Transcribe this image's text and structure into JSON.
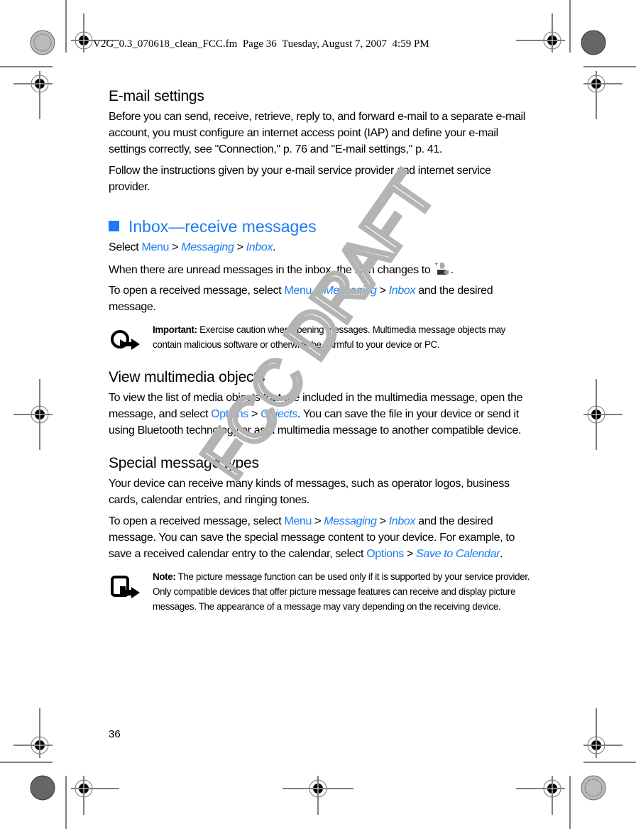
{
  "header": {
    "file_line": "V2G_0.3_070618_clean_FCC.fm  Page 36  Tuesday, August 7, 2007  4:59 PM"
  },
  "email_settings": {
    "heading": "E-mail settings",
    "p1": "Before you can send, receive, retrieve, reply to, and forward e-mail to a separate e-mail account, you must configure an internet access point (IAP) and define your e-mail settings correctly, see \"Connection,\" p. 76 and \"E-mail settings,\" p. 41.",
    "p2": "Follow the instructions given by your e-mail service provider and internet service provider."
  },
  "inbox": {
    "heading": "Inbox—receive messages",
    "select_prefix": "Select ",
    "menu": "Menu",
    "sep": " > ",
    "messaging": "Messaging",
    "inbox": "Inbox",
    "period": ".",
    "unread_text": "When there are unread messages in the inbox, the icon changes to ",
    "unread_icon": "new-message-inbox-icon",
    "open_prefix": "To open a received message, select ",
    "open_suffix": " and the desired message.",
    "important_label": "Important:",
    "important_text": " Exercise caution when opening messages. Multimedia message objects may contain malicious software or otherwise be harmful to your device or PC."
  },
  "multimedia": {
    "heading": "View multimedia objects",
    "p_prefix": "To view the list of media objects that are included in the multimedia message, open the message, and select ",
    "options": "Options",
    "objects": "Objects",
    "p_suffix": ". You can save the file in your device or send it using Bluetooth technology or as a multimedia message to another compatible device."
  },
  "special": {
    "heading": "Special message types",
    "p1": "Your device can receive many kinds of messages, such as operator logos, business cards, calendar entries, and ringing tones.",
    "p2_prefix": "To open a received message, select ",
    "p2_middle": " and the desired message. You can save the special message content to your device. For example, to save a received calendar entry to the calendar, select ",
    "options": "Options",
    "save_to_calendar": "Save to Calendar",
    "note_label": "Note:",
    "note_text": " The picture message function can be used only if it is supported by your service provider. Only compatible devices that offer picture message features can receive and display picture messages. The appearance of a message may vary depending on the receiving device."
  },
  "footer": {
    "page_number": "36"
  },
  "watermark": {
    "text": "FCC DRAFT"
  },
  "colors": {
    "accent": "#1a7cf0",
    "watermark": "#b4b4b4"
  }
}
